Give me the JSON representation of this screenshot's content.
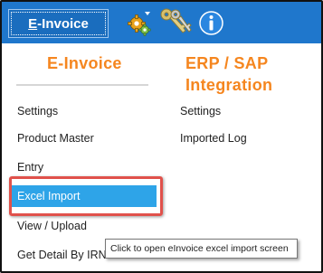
{
  "toolbar": {
    "tab_label_first": "E",
    "tab_label_rest": "-Invoice",
    "icons": [
      "gear-icon",
      "key-icon",
      "info-icon"
    ],
    "accent_color": "#1f77cc"
  },
  "einvoice_column": {
    "title": "E-Invoice",
    "items": [
      "Settings",
      "Product Master",
      "Entry",
      "Excel Import",
      "View / Upload",
      "Get Detail By IRN"
    ],
    "selected": "Excel Import"
  },
  "erp_column": {
    "title_line1": "ERP / SAP",
    "title_line2": "Integration",
    "items": [
      "Settings",
      "Imported Log"
    ]
  },
  "tooltip": {
    "text": "Click to open eInvoice excel import screen"
  },
  "colors": {
    "title_orange": "#f5861f",
    "selected_blue": "#2ea4e8",
    "highlight_red": "#e0514b"
  }
}
